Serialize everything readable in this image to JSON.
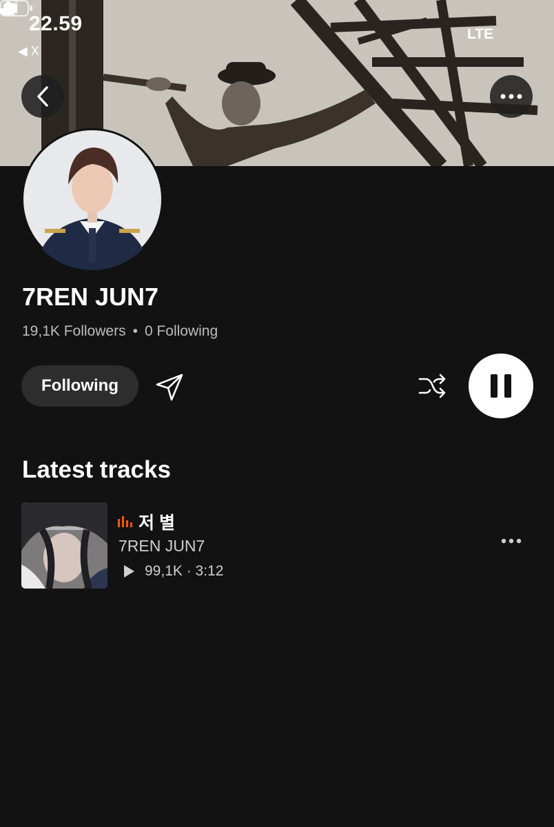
{
  "status_bar": {
    "time": "22.59",
    "back_app": "◀ X",
    "network": "LTE"
  },
  "icons": {
    "back": "chevron-left-icon",
    "more": "more-horizontal-icon",
    "share": "send-icon",
    "shuffle": "shuffle-icon",
    "pause": "pause-icon",
    "play": "play-icon",
    "now_playing": "equalizer-bars-icon"
  },
  "colors": {
    "background": "#121212",
    "accent": "#ff5500",
    "button_bg": "#2d2d2d"
  },
  "profile": {
    "name": "7REN JUN7",
    "followers": "19,1K Followers",
    "following": "0 Following",
    "separator": "•"
  },
  "actions": {
    "follow_label": "Following"
  },
  "latest_tracks": {
    "title": "Latest tracks",
    "items": [
      {
        "title": "저 별",
        "artist": "7REN JUN7",
        "plays_duration": "99,1K · 3:12"
      }
    ]
  }
}
